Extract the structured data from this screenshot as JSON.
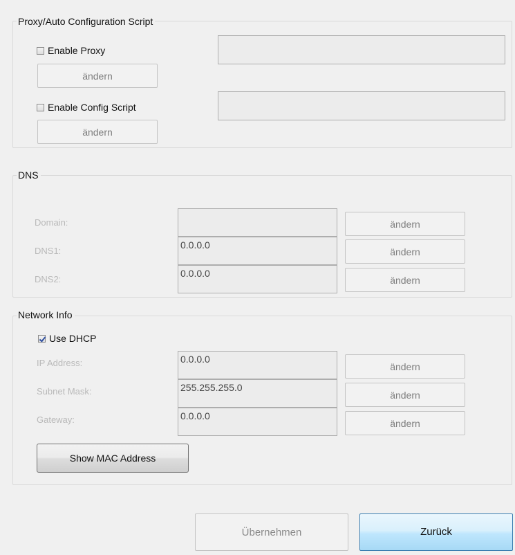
{
  "proxy": {
    "title": "Proxy/Auto Configuration Script",
    "enable_proxy": {
      "label": "Enable Proxy",
      "checked": false,
      "value": ""
    },
    "enable_config_script": {
      "label": "Enable Config Script",
      "checked": false,
      "value": ""
    },
    "change_label": "ändern"
  },
  "dns": {
    "title": "DNS",
    "rows": [
      {
        "label": "Domain:",
        "value": "",
        "button": "ändern"
      },
      {
        "label": "DNS1:",
        "value": "0.0.0.0",
        "button": "ändern"
      },
      {
        "label": "DNS2:",
        "value": "0.0.0.0",
        "button": "ändern"
      }
    ]
  },
  "network": {
    "title": "Network Info",
    "use_dhcp": {
      "label": "Use DHCP",
      "checked": true
    },
    "rows": [
      {
        "label": "IP Address:",
        "value": "0.0.0.0",
        "button": "ändern"
      },
      {
        "label": "Subnet Mask:",
        "value": "255.255.255.0",
        "button": "ändern"
      },
      {
        "label": "Gateway:",
        "value": "0.0.0.0",
        "button": "ändern"
      }
    ],
    "show_mac_label": "Show MAC Address"
  },
  "footer": {
    "apply_label": "Übernehmen",
    "back_label": "Zurück"
  }
}
